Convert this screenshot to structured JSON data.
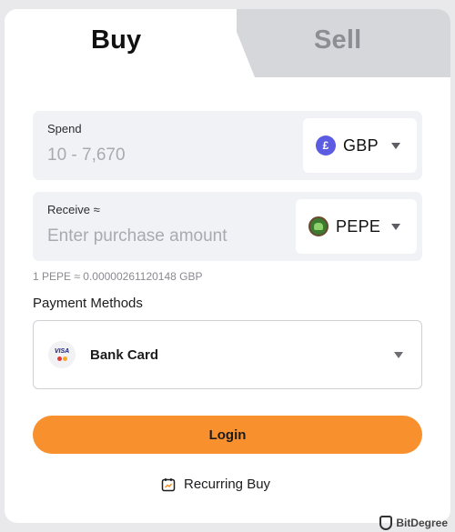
{
  "tabs": {
    "buy": "Buy",
    "sell": "Sell"
  },
  "spend": {
    "label": "Spend",
    "placeholder": "10 - 7,670",
    "currency": {
      "code": "GBP",
      "symbol": "£",
      "icon": "pound-coin-icon",
      "color": "#5b5ce2"
    }
  },
  "receive": {
    "label": "Receive ≈",
    "placeholder": "Enter purchase amount",
    "currency": {
      "code": "PEPE",
      "icon": "pepe-coin-icon"
    }
  },
  "rate": "1 PEPE ≈ 0.00000261120148 GBP",
  "payment": {
    "title": "Payment Methods",
    "selected": "Bank Card",
    "icon": "visa-mastercard-icon"
  },
  "login_button": "Login",
  "recurring": {
    "label": "Recurring Buy",
    "icon": "calendar-icon"
  },
  "watermark": "BitDegree",
  "colors": {
    "accent": "#f7902d",
    "tab_inactive_bg": "#d6d7db",
    "field_bg": "#f1f2f5"
  }
}
